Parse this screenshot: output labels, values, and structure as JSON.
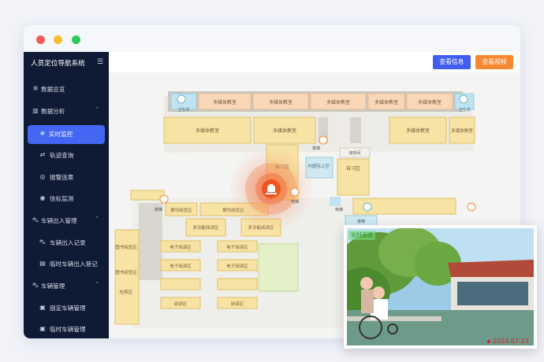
{
  "app": {
    "title": "人员定位导航系统"
  },
  "sidebar": {
    "items": [
      {
        "label": "数据总览",
        "icon": "gear-icon"
      },
      {
        "label": "数据分析",
        "icon": "chart-icon"
      },
      {
        "label": "实时监控",
        "icon": "monitor-icon",
        "active": true
      },
      {
        "label": "轨迹查询",
        "icon": "track-icon"
      },
      {
        "label": "报警违章",
        "icon": "alarm-icon"
      },
      {
        "label": "信标监测",
        "icon": "beacon-icon"
      },
      {
        "label": "车辆出入管理",
        "icon": "car-icon"
      },
      {
        "label": "车辆出入记录",
        "icon": "car-icon"
      },
      {
        "label": "临时车辆出入登记",
        "icon": "register-icon"
      },
      {
        "label": "车辆管理",
        "icon": "car-icon"
      },
      {
        "label": "固定车辆管理",
        "icon": "document-icon"
      },
      {
        "label": "临时车辆管理",
        "icon": "document-icon"
      }
    ]
  },
  "toolbar": {
    "view_info": "查看信息",
    "view_video": "查看视频"
  },
  "map": {
    "rooms": {
      "multimedia": "多媒体教室",
      "restroom": "卫生间",
      "stairs": "楼梯",
      "elevator": "电梯",
      "self_study": "自习区",
      "indoor_rooftop": "内庭院上空",
      "storage": "储物间",
      "e_reading": "电子阅读区",
      "reading": "阅读区",
      "magazine": "期刊阅览区",
      "multi_reading": "多功能阅读区",
      "book_reading": "图书阅览区",
      "search": "检索区"
    }
  },
  "video": {
    "tag": "实时画面",
    "date": "2024.07.23"
  },
  "colors": {
    "accent": "#4466f2",
    "orange": "#f7882f",
    "sidebar": "#0f1b34",
    "alarm": "#f0531f"
  }
}
